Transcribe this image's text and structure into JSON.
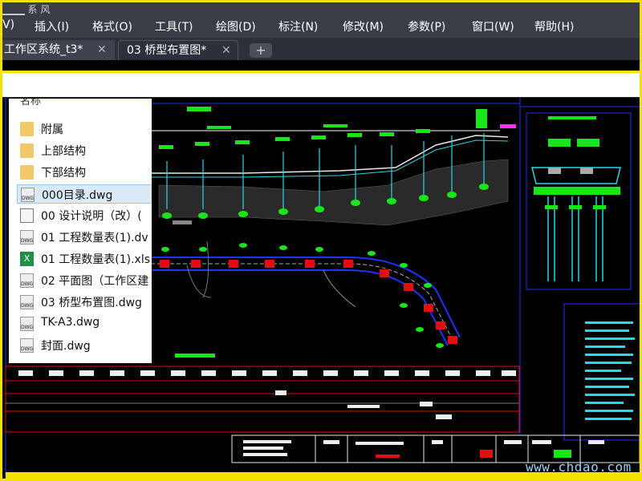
{
  "window": {
    "title_fragment": "▁▁▁ 系 风"
  },
  "menu": {
    "items": [
      "V)",
      "插入(I)",
      "格式(O)",
      "工具(T)",
      "绘图(D)",
      "标注(N)",
      "修改(M)",
      "参数(P)",
      "窗口(W)",
      "帮助(H)"
    ]
  },
  "tabs": [
    {
      "label": "工作区系统_t3*",
      "close": "✕"
    },
    {
      "label": "03 桥型布置图*",
      "close": "✕"
    }
  ],
  "tab_add": "+",
  "file_list": {
    "header": "名称",
    "items": [
      {
        "label": "附属",
        "type": "folder"
      },
      {
        "label": "上部结构",
        "type": "folder"
      },
      {
        "label": "下部结构",
        "type": "folder"
      },
      {
        "label": "000目录.dwg",
        "type": "dwg"
      },
      {
        "label": "00 设计说明（改）(",
        "type": "doc"
      },
      {
        "label": "01 工程数量表(1).dv",
        "type": "dwg"
      },
      {
        "label": "01 工程数量表(1).xls",
        "type": "xls"
      },
      {
        "label": "02 平面图（工作区建",
        "type": "dwg"
      },
      {
        "label": "03 桥型布置图.dwg",
        "type": "dwg"
      },
      {
        "label": "TK-A3.dwg",
        "type": "dwg"
      },
      {
        "label": "封面.dwg",
        "type": "dwg"
      }
    ]
  },
  "watermark": "www.chdao.com",
  "colors": {
    "frame": "#f3e200",
    "menubar": "#3b3e47",
    "cad_bg": "#000000",
    "cad_green": "#19e619",
    "cad_red": "#e01010",
    "cad_cyan": "#26d9e6",
    "cad_blue": "#2030ff"
  }
}
